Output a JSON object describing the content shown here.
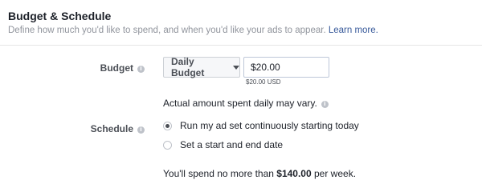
{
  "section": {
    "title": "Budget & Schedule",
    "description": "Define how much you'd like to spend, and when you'd like your ads to appear.",
    "learn_more": "Learn more."
  },
  "budget": {
    "label": "Budget",
    "type_selected": "Daily Budget",
    "amount_value": "$20.00",
    "amount_sub": "$20.00 USD",
    "note": "Actual amount spent daily may vary."
  },
  "schedule": {
    "label": "Schedule",
    "options": [
      {
        "label": "Run my ad set continuously starting today",
        "checked": true
      },
      {
        "label": "Set a start and end date",
        "checked": false
      }
    ]
  },
  "summary": {
    "prefix": "You'll spend no more than ",
    "amount": "$140.00",
    "suffix": " per week."
  },
  "icons": {
    "info": "info-icon",
    "dropdown": "caret-down-icon"
  },
  "colors": {
    "link": "#365899",
    "muted": "#90949c",
    "text": "#1d2129"
  }
}
